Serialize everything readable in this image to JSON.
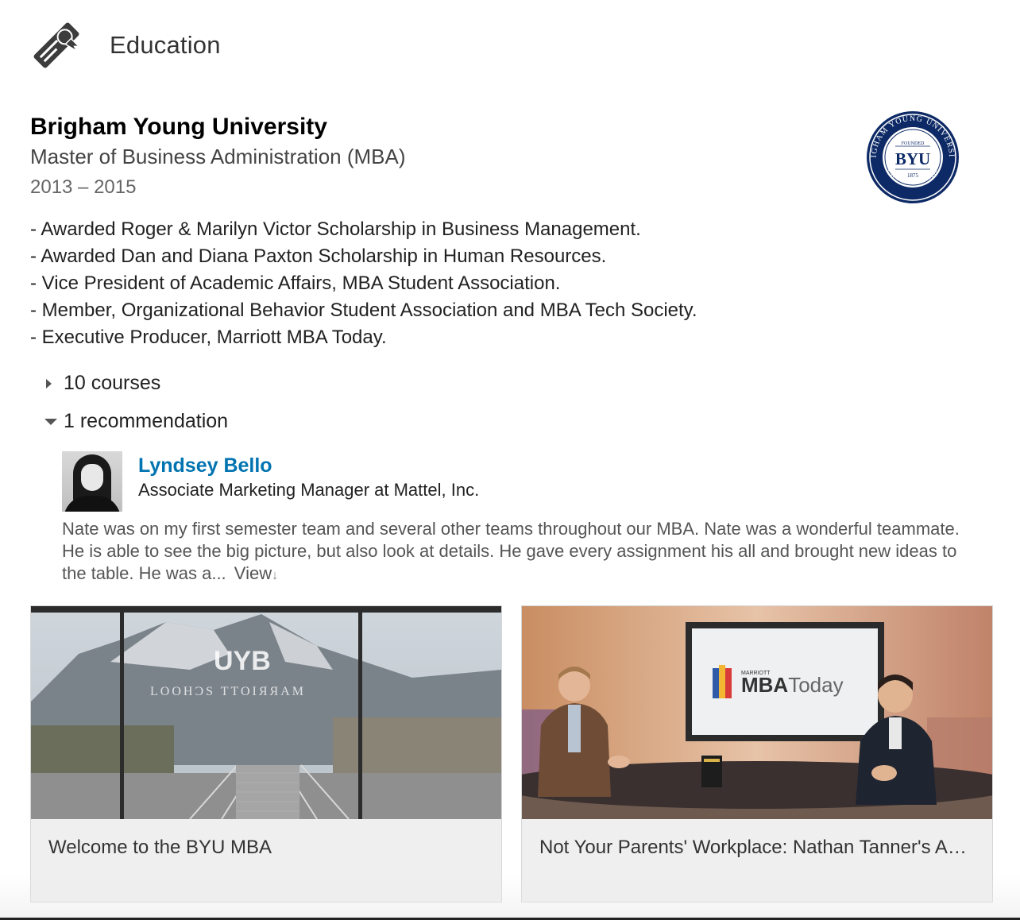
{
  "section": {
    "title": "Education",
    "icon": "diploma-icon"
  },
  "school": {
    "name": "Brigham Young University",
    "degree": "Master of Business Administration (MBA)",
    "dates": "2013 – 2015",
    "seal_icon": "byu-seal-icon"
  },
  "activities": [
    "- Awarded Roger & Marilyn Victor Scholarship in Business Management.",
    "- Awarded Dan and Diana Paxton Scholarship in Human Resources.",
    "- Vice President of Academic Affairs, MBA Student Association.",
    "- Member, Organizational Behavior Student Association and MBA Tech Society.",
    "- Executive Producer, Marriott MBA Today."
  ],
  "courses_toggle": {
    "label": "10 courses",
    "expanded": false
  },
  "recommendations_toggle": {
    "label": "1 recommendation",
    "expanded": true
  },
  "recommendation": {
    "name": "Lyndsey Bello",
    "title": "Associate Marketing Manager at Mattel, Inc.",
    "text": "Nate was on my first semester team and several other teams throughout our MBA. Nate was a wonderful teammate. He is able to see the big picture, but also look at details. He gave every assignment his all and brought new ideas to the table. He was a...",
    "view_label": "View",
    "view_arrow": "↓"
  },
  "media": [
    {
      "caption": "Welcome to the BYU MBA"
    },
    {
      "caption": "Not Your Parents' Workplace: Nathan Tanner's Appearance on Marriott MBA Today"
    }
  ],
  "colors": {
    "link_blue": "#0073b1",
    "byu_navy": "#0d2a66"
  }
}
